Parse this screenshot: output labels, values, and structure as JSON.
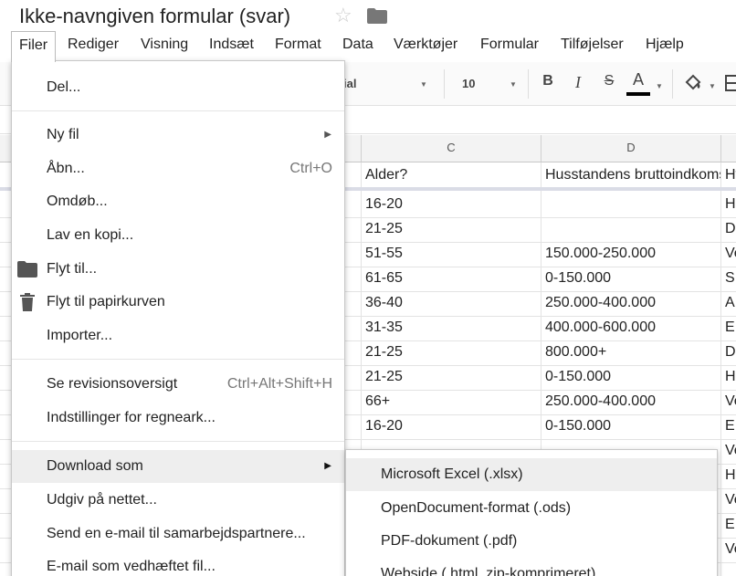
{
  "title": {
    "doc_name": "Ikke-navngiven formular (svar)",
    "star": "☆"
  },
  "menubar": [
    "Filer",
    "Rediger",
    "Visning",
    "Indsæt",
    "Format",
    "Data",
    "Værktøjer",
    "Formular",
    "Tilføjelser",
    "Hjælp"
  ],
  "toolbar": {
    "font": "ial",
    "font_size": "10",
    "bold": "B",
    "italic": "I",
    "strike": "S",
    "text_color": "A"
  },
  "grid": {
    "columns": [
      "C",
      "D"
    ],
    "header_row": [
      "Alder?",
      "Husstandens bruttoindkomst",
      "Hv"
    ],
    "rows": [
      [
        "16-20",
        "",
        "H"
      ],
      [
        "21-25",
        "",
        "D"
      ],
      [
        "51-55",
        "150.000-250.000",
        "Ve"
      ],
      [
        "61-65",
        "0-150.000",
        "S"
      ],
      [
        "36-40",
        "250.000-400.000",
        "A"
      ],
      [
        "31-35",
        "400.000-600.000",
        "E"
      ],
      [
        "21-25",
        "800.000+",
        "D"
      ],
      [
        "21-25",
        "0-150.000",
        "H"
      ],
      [
        "66+",
        "250.000-400.000",
        "Ve"
      ],
      [
        "16-20",
        "0-150.000",
        "E"
      ],
      [
        "",
        "",
        "Ve"
      ],
      [
        "",
        "",
        "H"
      ],
      [
        "",
        "",
        "Ve"
      ],
      [
        "",
        "",
        "E"
      ],
      [
        "",
        "",
        "Ve"
      ]
    ]
  },
  "file_menu": {
    "share": "Del...",
    "new_file": "Ny fil",
    "open": "Åbn...",
    "open_shortcut": "Ctrl+O",
    "rename": "Omdøb...",
    "make_copy": "Lav en kopi...",
    "move_to": "Flyt til...",
    "move_to_trash": "Flyt til papirkurven",
    "import": "Importer...",
    "revision_history": "Se revisionsoversigt",
    "revision_shortcut": "Ctrl+Alt+Shift+H",
    "spreadsheet_settings": "Indstillinger for regneark...",
    "download_as": "Download som",
    "publish": "Udgiv på nettet...",
    "email_collaborators": "Send en e-mail til samarbejdspartnere...",
    "email_attachment": "E-mail som vedhæftet fil..."
  },
  "download_submenu": [
    "Microsoft Excel (.xlsx)",
    "OpenDocument-format (.ods)",
    "PDF-dokument (.pdf)",
    "Webside (.html, zip-komprimeret)"
  ]
}
